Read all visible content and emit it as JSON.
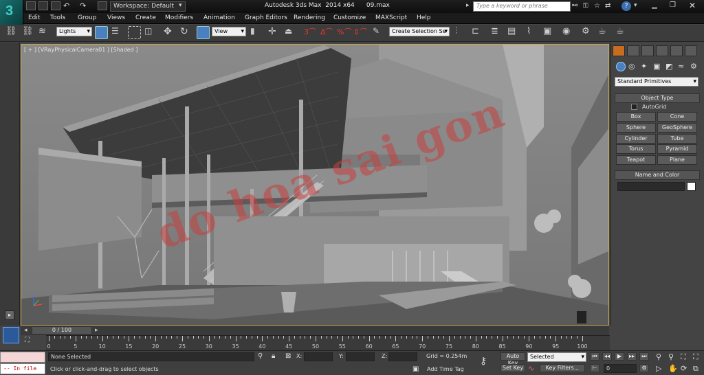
{
  "app": {
    "logo_text": "3",
    "window_title": "Autodesk 3ds Max  2014 x64      09.max",
    "workspace_label": "Workspace: Default",
    "search_placeholder": "Type a keyword or phrase"
  },
  "menu": [
    "Edit",
    "Tools",
    "Group",
    "Views",
    "Create",
    "Modifiers",
    "Animation",
    "Graph Editors",
    "Rendering",
    "Customize",
    "MAXScript",
    "Help"
  ],
  "toolbar": {
    "selection_filter": "Lights",
    "reference_coord": "View",
    "named_selection": "Create Selection Se"
  },
  "viewport": {
    "label": "[ + ] [VRayPhysicalCamera01 ] [Shaded ]",
    "watermark": "do hoa sai gon"
  },
  "command_panel": {
    "category": "Standard Primitives",
    "object_type_title": "Object Type",
    "autogrid_label": "AutoGrid",
    "buttons": [
      "Box",
      "Cone",
      "Sphere",
      "GeoSphere",
      "Cylinder",
      "Tube",
      "Torus",
      "Pyramid",
      "Teapot",
      "Plane"
    ],
    "name_color_title": "Name and Color"
  },
  "timeline": {
    "frame_display": "0 / 100",
    "ticks": [
      "0",
      "5",
      "10",
      "15",
      "20",
      "25",
      "30",
      "35",
      "40",
      "45",
      "50",
      "55",
      "60",
      "65",
      "70",
      "75",
      "80",
      "85",
      "90",
      "95",
      "100"
    ]
  },
  "status": {
    "maxscript_text": "-- In file",
    "selection_status": "None Selected",
    "prompt": "Click or click-and-drag to select objects",
    "x_label": "X:",
    "y_label": "Y:",
    "z_label": "Z:",
    "grid": "Grid = 0.254m",
    "add_time_tag": "Add Time Tag",
    "auto_key": "Auto Key",
    "set_key": "Set Key",
    "key_mode": "Selected",
    "key_filters": "Key Filters...",
    "frame_field": "0"
  },
  "colors": {
    "viewport_border": "#c8a84a",
    "watermark": "#c84040"
  }
}
